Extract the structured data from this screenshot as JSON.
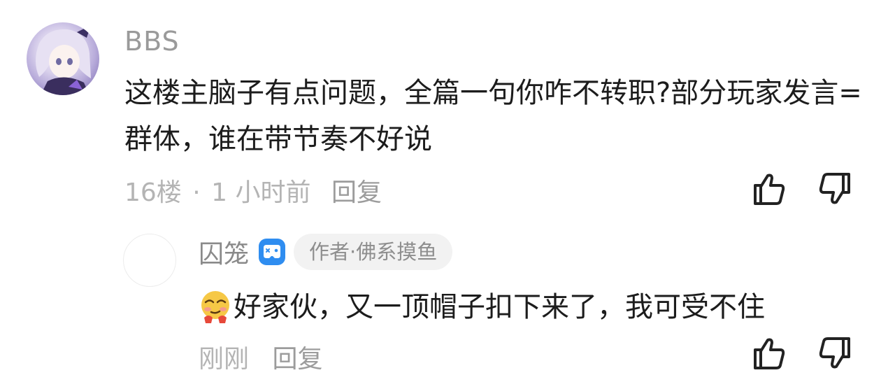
{
  "comment": {
    "username": "BBS",
    "text": "这楼主脑子有点问题，全篇一句你咋不转职?部分玩家发言=群体，谁在带节奏不好说",
    "floor": "16楼",
    "separator": "·",
    "time": "1 小时前",
    "reply_label": "回复",
    "avatar_icon": "anime-character-avatar",
    "like_icon": "thumbs-up-icon",
    "dislike_icon": "thumbs-down-icon"
  },
  "reply": {
    "username": "囚笼",
    "badge_icon": "gamepad-icon",
    "badge_color": "#2f8df0",
    "author_tag": "作者·佛系摸鱼",
    "emoji_icon": "smirk-emoji-icon",
    "text": "好家伙，又一顶帽子扣下来了，我可受不住",
    "time": "刚刚",
    "reply_label": "回复",
    "like_icon": "thumbs-up-icon",
    "dislike_icon": "thumbs-down-icon"
  }
}
